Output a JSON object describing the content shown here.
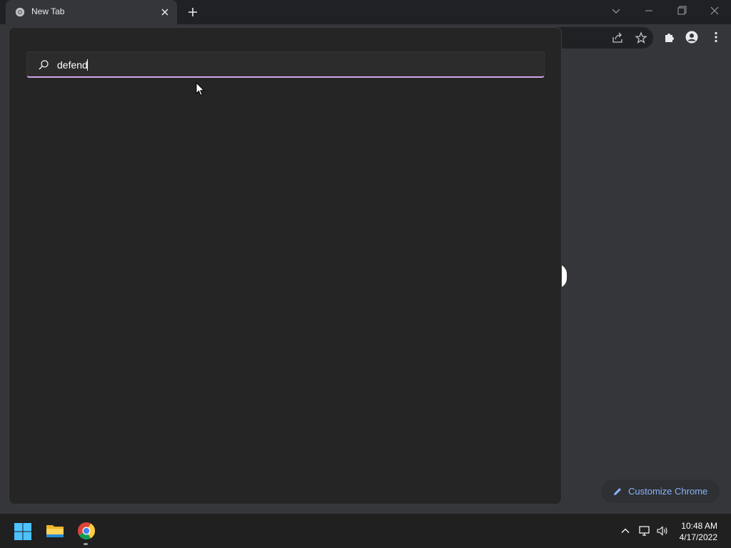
{
  "browser": {
    "tab_title": "New Tab",
    "customize_label": "Customize Chrome"
  },
  "search": {
    "query": "defend"
  },
  "taskbar": {
    "time": "10:48 AM",
    "date": "4/17/2022",
    "apps": [
      "start-icon",
      "file-explorer-icon",
      "chrome-icon"
    ]
  },
  "colors": {
    "search_underline": "#d3a5e8",
    "customize_text": "#8ab4f8",
    "browser_frame": "#202124",
    "flyout_bg": "#252525"
  }
}
